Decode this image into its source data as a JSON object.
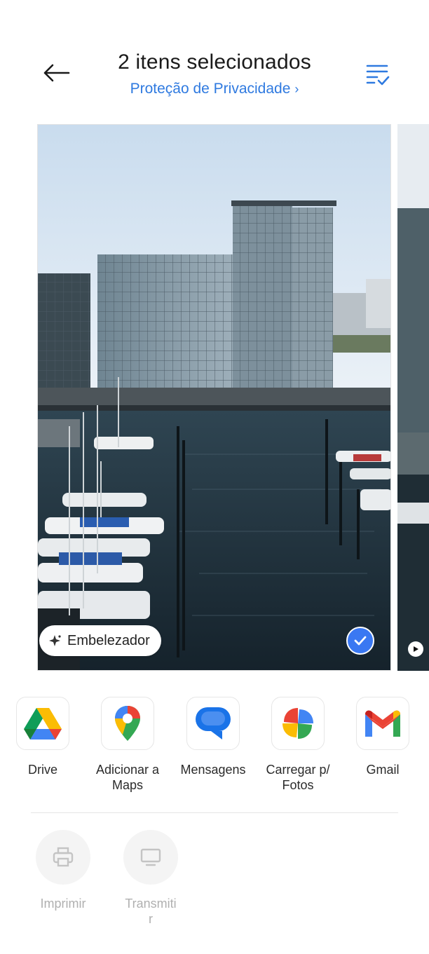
{
  "header": {
    "title": "2 itens selecionados",
    "subtitle": "Proteção de Privacidade",
    "subtitle_chevron": "›"
  },
  "photo": {
    "beautify_label": "Embelezador",
    "selected": true
  },
  "share_apps": [
    {
      "label": "Drive",
      "icon": "google-drive-icon"
    },
    {
      "label": "Adicionar a Maps",
      "icon": "google-maps-icon"
    },
    {
      "label": "Mensagens",
      "icon": "messages-icon"
    },
    {
      "label": "Carregar p/ Fotos",
      "icon": "google-photos-icon"
    },
    {
      "label": "Gmail",
      "icon": "gmail-icon"
    }
  ],
  "actions": [
    {
      "label": "Imprimir",
      "icon": "printer-icon"
    },
    {
      "label": "Transmitir",
      "icon": "cast-screen-icon"
    }
  ],
  "colors": {
    "accent": "#2f7ae0",
    "check": "#3a78f2",
    "disabled": "#b0b0b0"
  }
}
